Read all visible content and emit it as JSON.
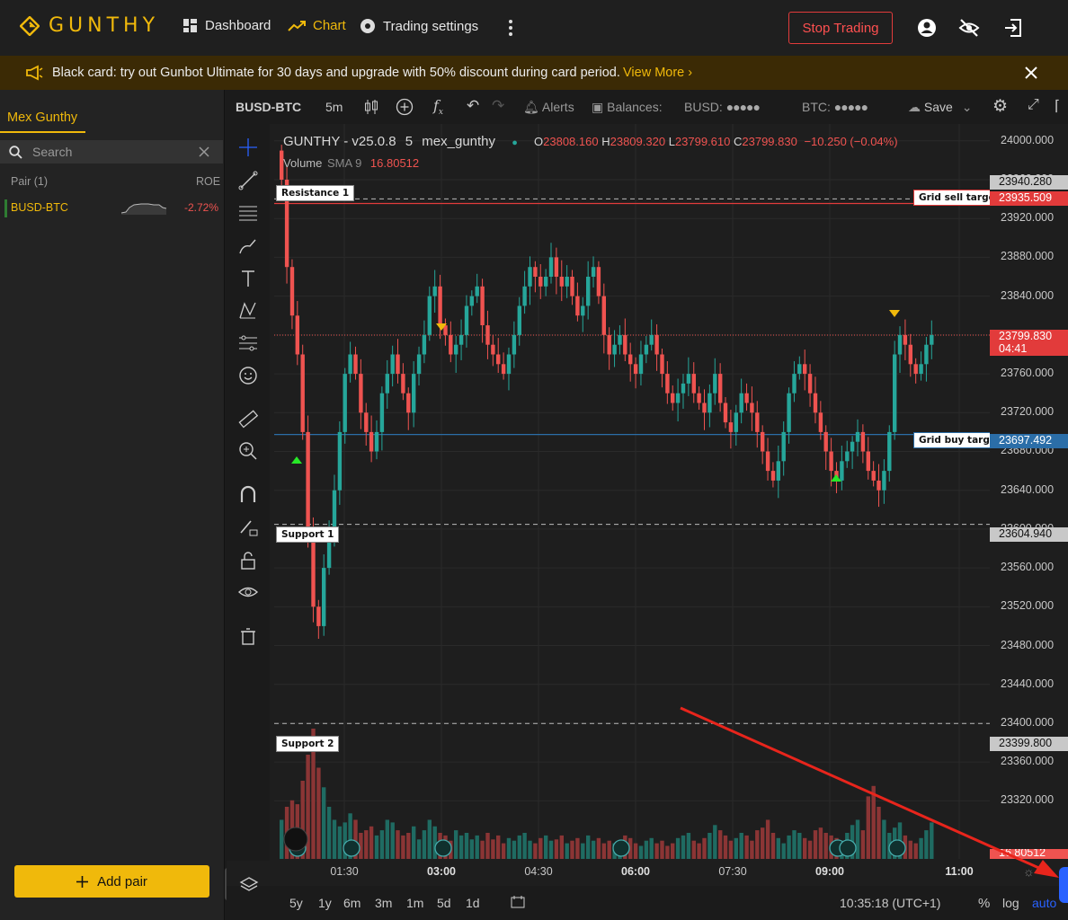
{
  "header": {
    "logo_text": "GUNTHY",
    "nav": [
      {
        "label": "Dashboard",
        "icon": "dashboard-icon"
      },
      {
        "label": "Chart",
        "icon": "chart-line-icon"
      },
      {
        "label": "Trading settings",
        "icon": "settings-gear-icon"
      }
    ],
    "stop_button": "Stop Trading",
    "icons": [
      "more-vertical-icon",
      "user-icon",
      "eye-off-icon",
      "logout-icon"
    ]
  },
  "banner": {
    "text": "Black card: try out Gunbot Ultimate for 30 days and upgrade with 50% discount during card period.",
    "link": "View More",
    "icons": [
      "megaphone-icon",
      "close-icon"
    ]
  },
  "sidebar": {
    "tab": "Mex Gunthy",
    "search_placeholder": "Search",
    "col_pair": "Pair (1)",
    "col_roe": "ROE",
    "rows": [
      {
        "pair": "BUSD-BTC",
        "roe": "-2.72%"
      }
    ],
    "add_pair": "Add pair"
  },
  "chart": {
    "toolbar": {
      "symbol": "BUSD-BTC",
      "interval": "5m",
      "alerts": "Alerts",
      "balances": "Balances:",
      "busd": "BUSD:",
      "btc": "BTC:",
      "save": "Save"
    },
    "legend": {
      "title": "GUNTHY - v25.0.8",
      "interval": "5",
      "source": "mex_gunthy",
      "o_label": "O",
      "o": "23808.160",
      "h_label": "H",
      "h": "23809.320",
      "l_label": "L",
      "l": "23799.610",
      "c_label": "C",
      "c": "23799.830",
      "change": "−10.250 (−0.04%)",
      "volume_label": "Volume",
      "sma_label": "SMA 9",
      "sma_value": "16.80512"
    },
    "price_ticks": [
      "24000.000",
      "23960.000",
      "23920.000",
      "23880.000",
      "23840.000",
      "23800.000",
      "23760.000",
      "23720.000",
      "23680.000",
      "23640.000",
      "23600.000",
      "23560.000",
      "23520.000",
      "23480.000",
      "23440.000",
      "23400.000",
      "23360.000",
      "23320.000"
    ],
    "levels": {
      "resistance_1": {
        "label": "Resistance 1",
        "price": "23940.280"
      },
      "grid_sell": {
        "label": "Grid sell target",
        "price": "23935.509"
      },
      "current": {
        "price": "23799.830",
        "countdown": "04:41"
      },
      "grid_buy": {
        "label": "Grid buy target",
        "price": "23697.492"
      },
      "support_1": {
        "label": "Support 1",
        "price": "23604.940"
      },
      "support_2": {
        "label": "Support 2",
        "price": "23399.800"
      },
      "volume_last": "16.80512"
    },
    "time_ticks": [
      {
        "label": "01:30",
        "bold": false
      },
      {
        "label": "03:00",
        "bold": true
      },
      {
        "label": "04:30",
        "bold": false
      },
      {
        "label": "06:00",
        "bold": true
      },
      {
        "label": "07:30",
        "bold": false
      },
      {
        "label": "09:00",
        "bold": true
      },
      {
        "label": "11:00",
        "bold": true
      }
    ],
    "bottom": {
      "ranges": [
        "5y",
        "1y",
        "6m",
        "3m",
        "1m",
        "5d",
        "1d"
      ],
      "clock": "10:35:18 (UTC+1)",
      "pct": "%",
      "log": "log",
      "auto": "auto"
    },
    "colors": {
      "up": "#26a69a",
      "down": "#ef5350",
      "accent": "#f0b90b",
      "buy_line": "#2b6ea8",
      "sell_line": "#e23b3b"
    }
  },
  "chart_data": {
    "type": "candlestick",
    "price_range": [
      23300,
      24010
    ],
    "closes": [
      23960,
      23870,
      23820,
      23780,
      23700,
      23600,
      23520,
      23500,
      23560,
      23600,
      23640,
      23700,
      23760,
      23780,
      23760,
      23720,
      23700,
      23680,
      23700,
      23740,
      23760,
      23780,
      23760,
      23740,
      23720,
      23760,
      23780,
      23800,
      23840,
      23850,
      23810,
      23800,
      23780,
      23790,
      23800,
      23830,
      23840,
      23850,
      23810,
      23790,
      23780,
      23770,
      23760,
      23780,
      23800,
      23830,
      23850,
      23870,
      23860,
      23850,
      23860,
      23880,
      23860,
      23850,
      23860,
      23840,
      23820,
      23830,
      23860,
      23870,
      23840,
      23800,
      23780,
      23790,
      23800,
      23780,
      23770,
      23760,
      23780,
      23790,
      23800,
      23780,
      23760,
      23740,
      23730,
      23740,
      23750,
      23760,
      23740,
      23730,
      23720,
      23740,
      23760,
      23730,
      23710,
      23700,
      23720,
      23740,
      23730,
      23720,
      23700,
      23680,
      23660,
      23650,
      23670,
      23700,
      23740,
      23760,
      23770,
      23760,
      23740,
      23720,
      23700,
      23680,
      23660,
      23650,
      23670,
      23680,
      23690,
      23700,
      23680,
      23660,
      23650,
      23640,
      23660,
      23700,
      23780,
      23800,
      23790,
      23770,
      23760,
      23770,
      23790,
      23800
    ],
    "volume": [
      30,
      40,
      45,
      42,
      60,
      80,
      100,
      70,
      55,
      40,
      30,
      25,
      28,
      35,
      30,
      20,
      22,
      25,
      18,
      22,
      30,
      28,
      22,
      18,
      20,
      25,
      15,
      22,
      30,
      25,
      20,
      18,
      14,
      22,
      18,
      20,
      15,
      18,
      14,
      20,
      15,
      18,
      12,
      16,
      14,
      18,
      20,
      14,
      12,
      16,
      18,
      14,
      15,
      18,
      12,
      14,
      16,
      12,
      18,
      14,
      16,
      12,
      14,
      12,
      14,
      18,
      16,
      12,
      10,
      14,
      16,
      12,
      14,
      10,
      12,
      16,
      18,
      20,
      14,
      12,
      16,
      20,
      26,
      22,
      18,
      14,
      16,
      20,
      18,
      14,
      22,
      24,
      30,
      20,
      16,
      12,
      18,
      22,
      20,
      16,
      14,
      22,
      24,
      20,
      18,
      16,
      14,
      20,
      26,
      30,
      22,
      48,
      56,
      40,
      30,
      20,
      24,
      28,
      18,
      14,
      12,
      16,
      22,
      28
    ]
  }
}
